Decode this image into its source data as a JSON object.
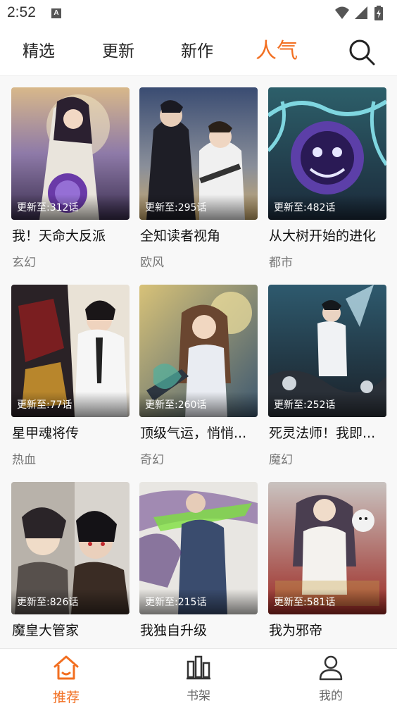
{
  "status_bar": {
    "time": "2:52",
    "notification_icon": "A",
    "icons": [
      "wifi-icon",
      "cell-signal-icon",
      "battery-icon"
    ]
  },
  "top_tabs": [
    {
      "label": "精选",
      "active": false
    },
    {
      "label": "更新",
      "active": false
    },
    {
      "label": "新作",
      "active": false
    },
    {
      "label": "人气",
      "active": true
    }
  ],
  "search": {
    "icon": "search-icon"
  },
  "comics": [
    {
      "title": "我！天命大反派",
      "genre": "玄幻",
      "update": "更新至:312话"
    },
    {
      "title": "全知读者视角",
      "genre": "欧风",
      "update": "更新至:295话"
    },
    {
      "title": "从大树开始的进化",
      "genre": "都市",
      "update": "更新至:482话"
    },
    {
      "title": "星甲魂将传",
      "genre": "热血",
      "update": "更新至:77话"
    },
    {
      "title": "顶级气运，悄悄...",
      "genre": "奇幻",
      "update": "更新至:260话"
    },
    {
      "title": "死灵法师！我即...",
      "genre": "魔幻",
      "update": "更新至:252话"
    },
    {
      "title": "魔皇大管家",
      "genre": "",
      "update": "更新至:826话"
    },
    {
      "title": "我独自升级",
      "genre": "",
      "update": "更新至:215话"
    },
    {
      "title": "我为邪帝",
      "genre": "",
      "update": "更新至:581话"
    }
  ],
  "bottom_nav": [
    {
      "label": "推荐",
      "icon": "home-icon",
      "active": true
    },
    {
      "label": "书架",
      "icon": "bookshelf-icon",
      "active": false
    },
    {
      "label": "我的",
      "icon": "profile-icon",
      "active": false
    }
  ],
  "colors": {
    "accent": "#f26f21",
    "text": "#222222",
    "muted": "#777777"
  }
}
